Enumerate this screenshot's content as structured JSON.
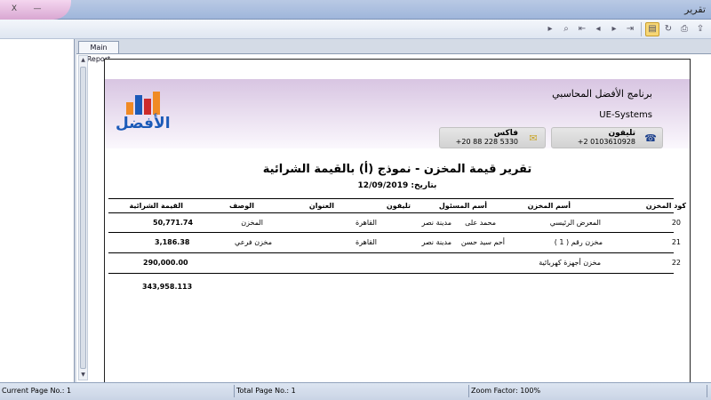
{
  "window": {
    "title": "تقرير",
    "minimize_glyph": "—",
    "close_glyph": "X"
  },
  "toolbar": {
    "icons": [
      "print-icon",
      "export-icon",
      "refresh-icon",
      "group-tree-icon",
      "last-page-icon",
      "next-page-icon",
      "prev-page-icon",
      "first-page-icon",
      "zoom-icon",
      "search-icon"
    ]
  },
  "tab": {
    "label": "Main Report"
  },
  "report": {
    "company_name": "برنامج الأفضل المحاسبي",
    "company_en": "UE-Systems",
    "phone_label": "تليفون",
    "phone_value": "+2 0103610928",
    "fax_label": "فاكس",
    "fax_value": "+20 88 228 5330",
    "logo_text": "الأفضل",
    "title": "تقرير قيمة المخزن - نموذج (أ) بالقيمة الشرائية",
    "date_label": "بتاريخ:",
    "date_value": "12/09/2019",
    "columns": {
      "code": "كود المخزن",
      "store_name": "أسم المخزن",
      "manager": "أسم المسئول",
      "phone": "تليفون",
      "address": "العنوان",
      "desc": "الوصف",
      "value": "القيمة الشرائية"
    },
    "rows": [
      {
        "code": "20",
        "store_name": "المعرض الرئيسي",
        "manager": "محمد على",
        "phone": "مدينة نصر",
        "address": "القاهرة",
        "desc": "المخزن",
        "value": "50,771.74"
      },
      {
        "code": "21",
        "store_name": "( مخزن رقم ( 1",
        "manager": "أحم سيد حسن",
        "phone": "مدينة نصر",
        "address": "القاهرة",
        "desc": "مخزن فرعي",
        "value": "3,186.38"
      },
      {
        "code": "22",
        "store_name": "مخزن أجهزة كهربائية",
        "manager": "",
        "phone": "",
        "address": "",
        "desc": "",
        "value": "290,000.00"
      }
    ],
    "total": "343,958.113"
  },
  "status": {
    "current_page": "Current Page No.: 1",
    "total_page": "Total Page No.: 1",
    "zoom": "Zoom Factor: 100%"
  },
  "colors": {
    "accent": "#1b5ab8",
    "header_band": "#d8c5e2"
  }
}
